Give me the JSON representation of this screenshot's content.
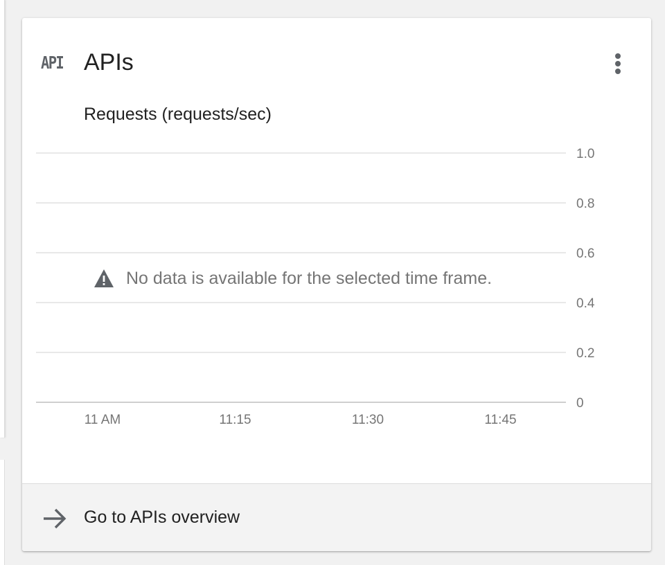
{
  "card": {
    "title": "APIs",
    "icon_text": "API",
    "more_icon": "more-vert-icon"
  },
  "chart_data": {
    "type": "line",
    "title": "Requests (requests/sec)",
    "x_ticks": [
      "11 AM",
      "11:15",
      "11:30",
      "11:45"
    ],
    "y_ticks": [
      "1.0",
      "0.8",
      "0.6",
      "0.4",
      "0.2",
      "0"
    ],
    "ylim": [
      0,
      1.0
    ],
    "grid": true,
    "series": []
  },
  "no_data": {
    "message": "No data is available for the selected time frame.",
    "icon": "warning-icon"
  },
  "footer": {
    "label": "Go to APIs overview",
    "icon": "arrow-forward-icon"
  },
  "colors": {
    "grid": "#e0e0e0",
    "axis": "#cfcfcf",
    "tick_text": "#757575",
    "icon": "#5f6368",
    "footer_bg": "#f3f3f3"
  }
}
